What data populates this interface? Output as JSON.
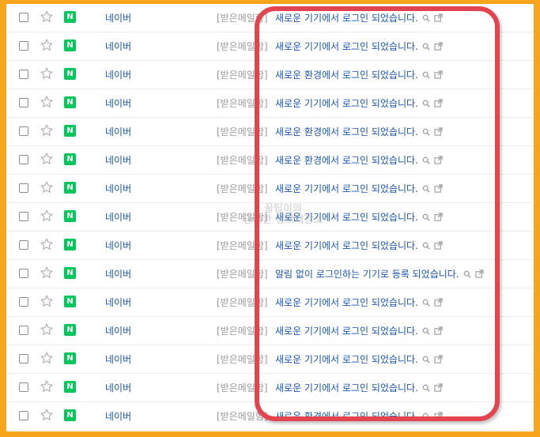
{
  "mail_rows": [
    {
      "badge": "N",
      "sender": "네이버",
      "tag": "[받은메일함]",
      "subject": "새로운 기기에서 로그인 되었습니다."
    },
    {
      "badge": "N",
      "sender": "네이버",
      "tag": "[받은메일함]",
      "subject": "새로운 기기에서 로그인 되었습니다."
    },
    {
      "badge": "N",
      "sender": "네이버",
      "tag": "[받은메일함]",
      "subject": "새로운 환경에서 로그인 되었습니다."
    },
    {
      "badge": "N",
      "sender": "네이버",
      "tag": "[받은메일함]",
      "subject": "새로운 기기에서 로그인 되었습니다."
    },
    {
      "badge": "N",
      "sender": "네이버",
      "tag": "[받은메일함]",
      "subject": "새로운 환경에서 로그인 되었습니다."
    },
    {
      "badge": "N",
      "sender": "네이버",
      "tag": "[받은메일함]",
      "subject": "새로운 환경에서 로그인 되었습니다."
    },
    {
      "badge": "N",
      "sender": "네이버",
      "tag": "[받은메일함]",
      "subject": "새로운 기기에서 로그인 되었습니다."
    },
    {
      "badge": "N",
      "sender": "네이버",
      "tag": "[받은메일함]",
      "subject": "새로운 기기에서 로그인 되었습니다."
    },
    {
      "badge": "N",
      "sender": "네이버",
      "tag": "[받은메일함]",
      "subject": "새로운 기기에서 로그인 되었습니다."
    },
    {
      "badge": "N",
      "sender": "네이버",
      "tag": "[받은메일함]",
      "subject": "알림 없이 로그인하는 기기로 등록 되었습니다."
    },
    {
      "badge": "N",
      "sender": "네이버",
      "tag": "[받은메일함]",
      "subject": "새로운 기기에서 로그인 되었습니다."
    },
    {
      "badge": "N",
      "sender": "네이버",
      "tag": "[받은메일함]",
      "subject": "새로운 기기에서 로그인 되었습니다."
    },
    {
      "badge": "N",
      "sender": "네이버",
      "tag": "[받은메일함]",
      "subject": "새로운 기기에서 로그인 되었습니다."
    },
    {
      "badge": "N",
      "sender": "네이버",
      "tag": "[받은메일함]",
      "subject": "새로운 기기에서 로그인 되었습니다."
    },
    {
      "badge": "N",
      "sender": "네이버",
      "tag": "[받은메일함]",
      "subject": "새로운 환경에서 로그인 되었습니다."
    }
  ],
  "watermark": {
    "line1": "꿀팁이의",
    "line2": "궁금한 정보저장소"
  },
  "colors": {
    "frame_border": "#f7a51c",
    "highlight": "#e2454f",
    "naver_green": "#03c75a",
    "link_blue": "#1a56b0"
  },
  "icons": {
    "row_checkbox": "checkbox-icon",
    "row_star": "star-icon",
    "row_preview": "magnifier-icon",
    "row_open": "external-link-icon"
  }
}
